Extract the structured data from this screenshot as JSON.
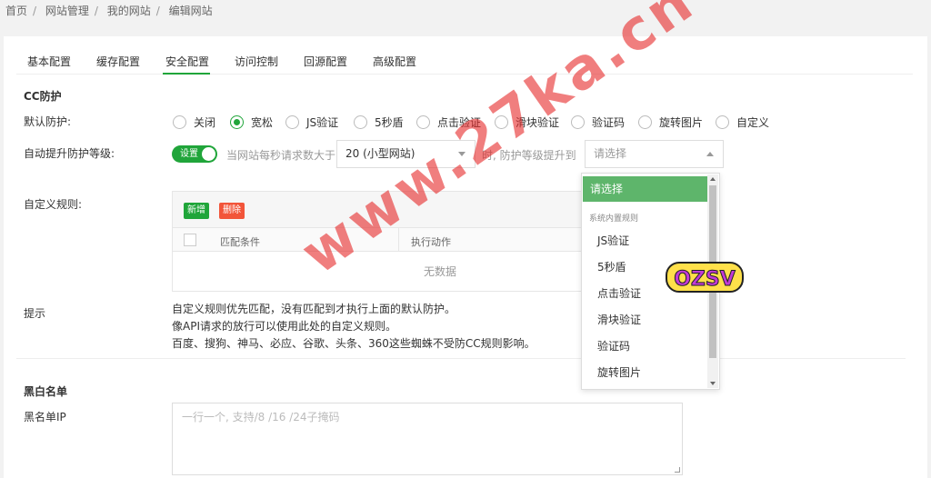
{
  "breadcrumb": [
    "首页",
    "网站管理",
    "我的网站",
    "编辑网站"
  ],
  "tabs": [
    "基本配置",
    "缓存配置",
    "安全配置",
    "访问控制",
    "回源配置",
    "高级配置"
  ],
  "active_tab": "安全配置",
  "cc": {
    "title": "CC防护",
    "default_label": "默认防护:",
    "options": [
      "关闭",
      "宽松",
      "JS验证",
      "5秒盾",
      "点击验证",
      "滑块验证",
      "验证码",
      "旋转图片",
      "自定义"
    ],
    "selected": "宽松",
    "auto_label": "自动提升防护等级:",
    "toggle_label": "设置",
    "qps_prefix": "当网站每秒请求数大于",
    "qps_value": "20 (小型网站)",
    "level_prefix": "时, 防护等级提升到",
    "level_placeholder": "请选择"
  },
  "custom_rules": {
    "label": "自定义规则:",
    "add_button": "新增",
    "delete_button": "删除",
    "col_match": "匹配条件",
    "col_action": "执行动作",
    "empty": "无数据"
  },
  "tips": {
    "label": "提示",
    "lines": [
      "自定义规则优先匹配，没有匹配到才执行上面的默认防护。",
      "像API请求的放行可以使用此处的自定义规则。",
      "百度、搜狗、神马、必应、谷歌、头条、360这些蜘蛛不受防CC规则影响。"
    ]
  },
  "blacklist": {
    "title": "黑白名单",
    "ip_label": "黑名单IP",
    "placeholder": "一行一个, 支持/8 /16 /24子掩码"
  },
  "dropdown": {
    "selected": "请选择",
    "group": "系统内置规则",
    "items": [
      "JS验证",
      "5秒盾",
      "点击验证",
      "滑块验证",
      "验证码",
      "旋转图片"
    ]
  },
  "overlays": {
    "watermark": "www.27ka.cn",
    "sticker": "OZSV"
  },
  "colors": {
    "accent": "#20a53a",
    "danger": "#f2553a",
    "add_button": "#20a53a",
    "dropdown_selected": "#5eb56b"
  }
}
